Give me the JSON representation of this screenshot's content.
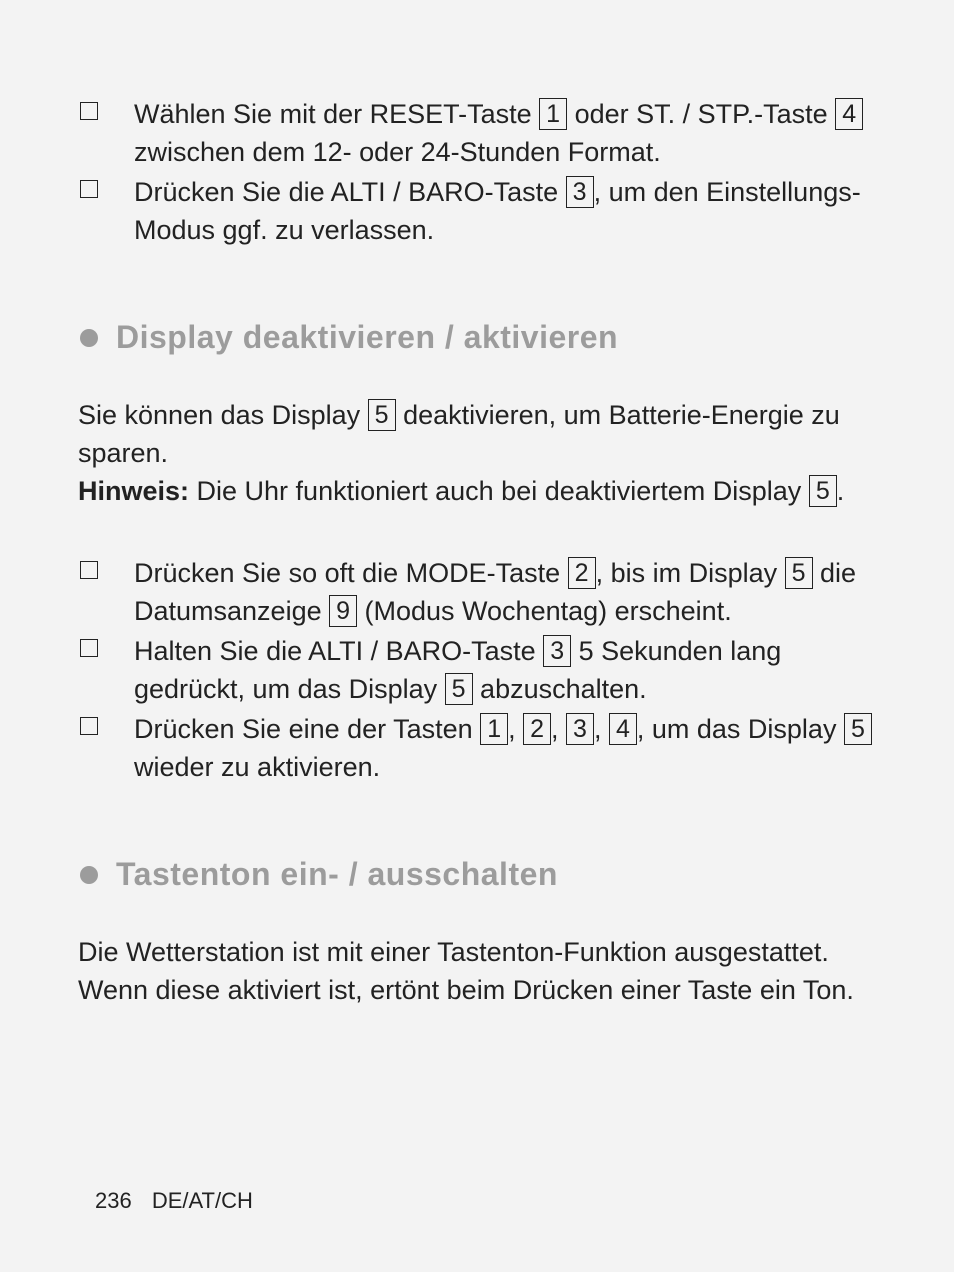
{
  "footer": {
    "page_number": "236",
    "locale": "DE/AT/CH"
  },
  "block1": {
    "items": [
      {
        "segments": [
          {
            "t": "text",
            "v": "Wählen Sie mit der RESET-Taste "
          },
          {
            "t": "box",
            "v": "1"
          },
          {
            "t": "text",
            "v": " oder ST. / STP.-Taste "
          },
          {
            "t": "box",
            "v": "4"
          },
          {
            "t": "text",
            "v": " zwischen dem 12- oder 24-Stunden Format."
          }
        ]
      },
      {
        "segments": [
          {
            "t": "text",
            "v": "Drücken Sie die ALTI / BARO-Taste "
          },
          {
            "t": "box",
            "v": "3"
          },
          {
            "t": "text",
            "v": ", um den Einstellungs-Modus ggf. zu verlassen."
          }
        ]
      }
    ]
  },
  "section1": {
    "heading": "Display deaktivieren / aktivieren",
    "intro": {
      "segments": [
        {
          "t": "text",
          "v": "Sie können das Display "
        },
        {
          "t": "box",
          "v": "5"
        },
        {
          "t": "text",
          "v": " deaktivieren, um Batterie-Energie zu sparen."
        }
      ]
    },
    "note": {
      "label": "Hinweis:",
      "segments": [
        {
          "t": "text",
          "v": " Die Uhr funktioniert auch bei deaktiviertem Display "
        },
        {
          "t": "box",
          "v": "5"
        },
        {
          "t": "text",
          "v": "."
        }
      ]
    },
    "items": [
      {
        "segments": [
          {
            "t": "text",
            "v": "Drücken Sie so oft die MODE-Taste "
          },
          {
            "t": "box",
            "v": "2"
          },
          {
            "t": "text",
            "v": ", bis im Display "
          },
          {
            "t": "box",
            "v": "5"
          },
          {
            "t": "text",
            "v": " die Datumsanzeige "
          },
          {
            "t": "box",
            "v": "9"
          },
          {
            "t": "text",
            "v": " (Modus Wochentag) erscheint."
          }
        ]
      },
      {
        "segments": [
          {
            "t": "text",
            "v": "Halten Sie die ALTI / BARO-Taste "
          },
          {
            "t": "box",
            "v": "3"
          },
          {
            "t": "text",
            "v": " 5 Sekunden lang gedrückt, um das Display "
          },
          {
            "t": "box",
            "v": "5"
          },
          {
            "t": "text",
            "v": " abzuschalten."
          }
        ]
      },
      {
        "segments": [
          {
            "t": "text",
            "v": "Drücken Sie eine der Tasten "
          },
          {
            "t": "box",
            "v": "1"
          },
          {
            "t": "text",
            "v": ", "
          },
          {
            "t": "box",
            "v": "2"
          },
          {
            "t": "text",
            "v": ", "
          },
          {
            "t": "box",
            "v": "3"
          },
          {
            "t": "text",
            "v": ", "
          },
          {
            "t": "box",
            "v": "4"
          },
          {
            "t": "text",
            "v": ", um das Display "
          },
          {
            "t": "box",
            "v": "5"
          },
          {
            "t": "text",
            "v": " wieder zu aktivieren."
          }
        ]
      }
    ]
  },
  "section2": {
    "heading": "Tastenton ein- / ausschalten",
    "intro": {
      "segments": [
        {
          "t": "text",
          "v": "Die Wetterstation ist mit einer Tastenton-Funktion ausgestattet. Wenn diese aktiviert ist, ertönt beim Drücken einer Taste ein Ton."
        }
      ]
    }
  }
}
